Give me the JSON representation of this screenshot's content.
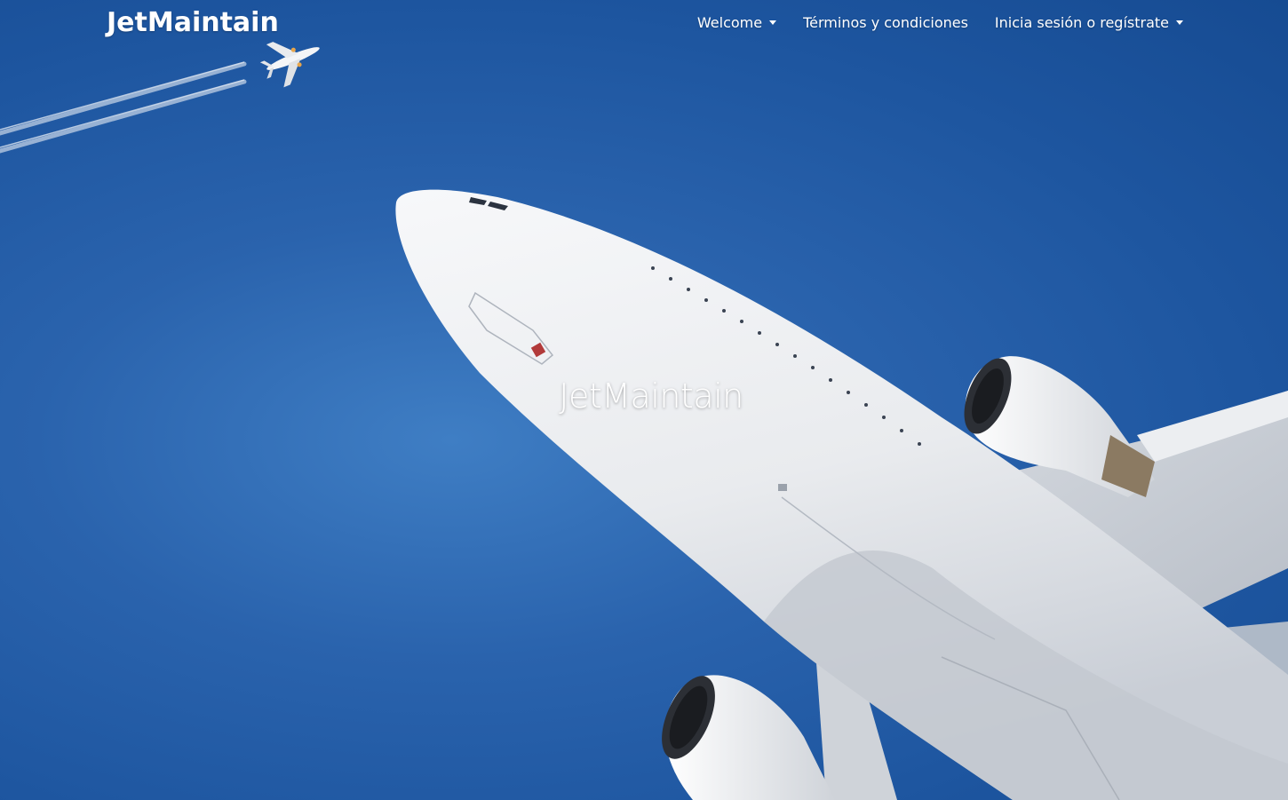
{
  "navbar": {
    "brand": "JetMaintain",
    "items": [
      {
        "label": "Welcome",
        "dropdown": true
      },
      {
        "label": "Términos y condiciones",
        "dropdown": false
      },
      {
        "label": "Inicia sesión o regístrate",
        "dropdown": true
      }
    ]
  },
  "hero": {
    "title": "JetMaintain",
    "background_image": "airplane-underside-photo",
    "sky_color": "#2a63ad"
  }
}
